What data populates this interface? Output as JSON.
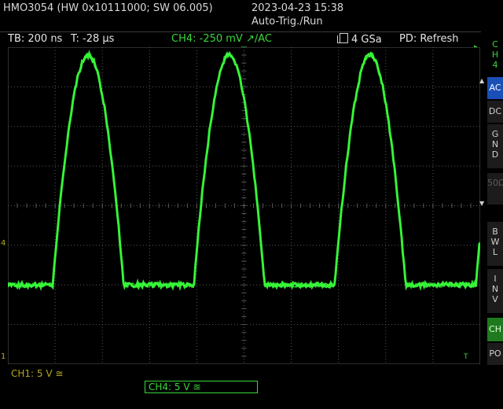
{
  "header": {
    "model": "HMO3054 (HW 0x10111000; SW 06.005)",
    "datetime": "2023-04-23 15:38",
    "mode": "Auto-Trig./Run"
  },
  "status": {
    "timebase": "TB: 200 ns",
    "trigger_time": "T: -28 µs",
    "channel": "CH4: -250 mV ↗/AC",
    "sample_rate": "4 GSa",
    "pd": "PD: Refresh"
  },
  "sidebar": {
    "channel": [
      "C",
      "H",
      "4"
    ],
    "buttons": [
      {
        "label": "AC",
        "state": "active"
      },
      {
        "label": "DC",
        "state": "normal"
      },
      {
        "label": "GND",
        "state": "normal"
      },
      {
        "label": "50Ω",
        "state": "disabled"
      },
      {
        "label": "BWL",
        "state": "normal"
      },
      {
        "label": "INV",
        "state": "normal"
      },
      {
        "label": "CH",
        "state": "selected"
      },
      {
        "label": "PO",
        "state": "normal"
      }
    ]
  },
  "bottom": {
    "ch1": "CH1: 5 V ≅",
    "ch4": "CH4: 5 V ≊"
  },
  "markers": {
    "trigger_level": "4",
    "ch1_ground": "1",
    "time_ref": "T"
  },
  "colors": {
    "trace": "#39ff3a",
    "grid": "#5a5a5a",
    "ch1": "#b5a820",
    "ch4": "#39d83a",
    "active_button": "#1b4fb8"
  },
  "waveform": {
    "type": "periodic-pulse",
    "periods_visible": 3,
    "high_level_div": 3.8,
    "low_level_div": -2.0
  }
}
